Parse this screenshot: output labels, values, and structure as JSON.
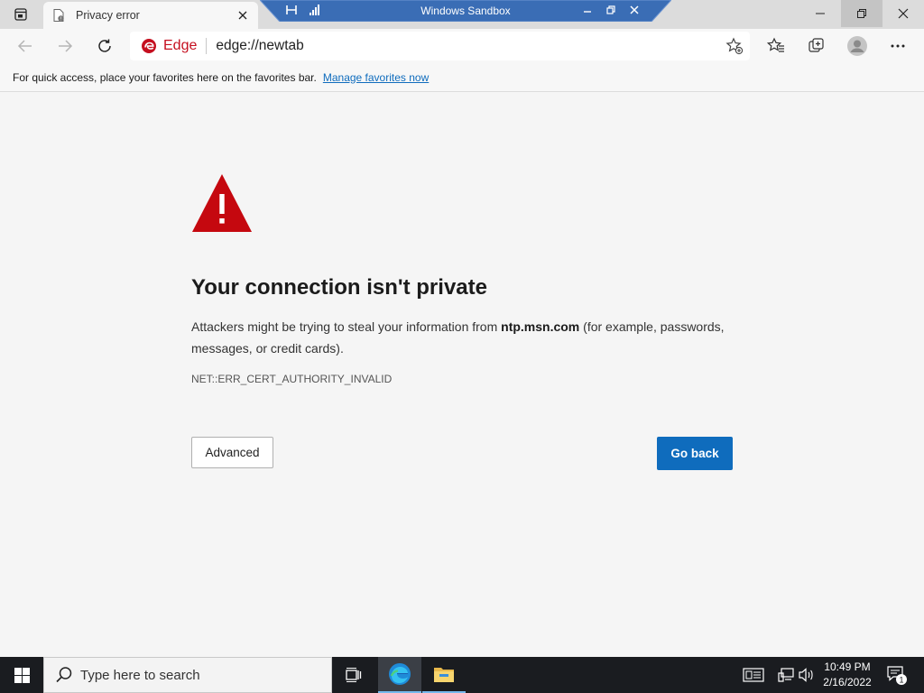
{
  "browser": {
    "tab": {
      "title": "Privacy error"
    },
    "sandbox": {
      "title": "Windows Sandbox"
    },
    "address": {
      "brand": "Edge",
      "url": "edge://newtab"
    },
    "favorites_bar": {
      "message": "For quick access, place your favorites here on the favorites bar.",
      "link": "Manage favorites now"
    }
  },
  "error_page": {
    "heading": "Your connection isn't private",
    "desc_before": "Attackers might be trying to steal your information from ",
    "host": "ntp.msn.com",
    "desc_after": " (for example, passwords, messages, or credit cards).",
    "error_code": "NET::ERR_CERT_AUTHORITY_INVALID",
    "advanced_label": "Advanced",
    "go_back_label": "Go back"
  },
  "taskbar": {
    "search_placeholder": "Type here to search",
    "time": "10:49 PM",
    "date": "2/16/2022",
    "notification_count": "1"
  },
  "colors": {
    "accent": "#0f6cbd",
    "warning_red": "#c5080f",
    "edge_red": "#c50f1f",
    "taskbar": "#1a1c20",
    "sandbox_bar": "#3a6db5"
  },
  "icons": [
    "tab-actions-icon",
    "document-icon",
    "close-icon",
    "pin-icon",
    "signal-icon",
    "minimize-icon",
    "restore-icon",
    "back-arrow-icon",
    "forward-arrow-icon",
    "refresh-icon",
    "edge-logo-icon",
    "add-favorite-icon",
    "favorites-icon",
    "collections-icon",
    "profile-icon",
    "more-icon",
    "warning-icon",
    "windows-logo-icon",
    "search-icon",
    "task-view-icon",
    "edge-app-icon",
    "file-explorer-icon",
    "keyboard-icon",
    "network-icon",
    "volume-icon",
    "notification-icon"
  ]
}
